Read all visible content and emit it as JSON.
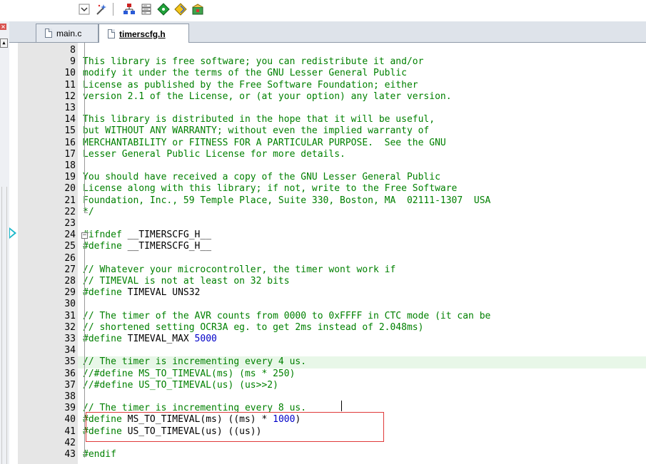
{
  "toolbar": {
    "buttons": [
      {
        "name": "dropdown-arrow-icon"
      },
      {
        "name": "magic-wand-icon"
      },
      {
        "name": "hierarchy-icon"
      },
      {
        "name": "stack-icon"
      },
      {
        "name": "green-diamond-icon"
      },
      {
        "name": "yellow-diamond-icon"
      },
      {
        "name": "package-icon"
      }
    ]
  },
  "tabs": [
    {
      "label": "main.c",
      "active": false
    },
    {
      "label": "timerscfg.h",
      "active": true
    }
  ],
  "editor": {
    "lines": [
      {
        "n": "8",
        "parts": [
          [
            "com",
            ""
          ]
        ]
      },
      {
        "n": "9",
        "parts": [
          [
            "com",
            "This library is free software; you can redistribute it and/or"
          ]
        ]
      },
      {
        "n": "10",
        "parts": [
          [
            "com",
            "modify it under the terms of the GNU Lesser General Public"
          ]
        ]
      },
      {
        "n": "11",
        "parts": [
          [
            "com",
            "License as published by the Free Software Foundation; either"
          ]
        ]
      },
      {
        "n": "12",
        "parts": [
          [
            "com",
            "version 2.1 of the License, or (at your option) any later version."
          ]
        ]
      },
      {
        "n": "13",
        "parts": [
          [
            "com",
            ""
          ]
        ]
      },
      {
        "n": "14",
        "parts": [
          [
            "com",
            "This library is distributed in the hope that it will be useful,"
          ]
        ]
      },
      {
        "n": "15",
        "parts": [
          [
            "com",
            "but WITHOUT ANY WARRANTY; without even the implied warranty of"
          ]
        ]
      },
      {
        "n": "16",
        "parts": [
          [
            "com",
            "MERCHANTABILITY or FITNESS FOR A PARTICULAR PURPOSE.  See the GNU"
          ]
        ]
      },
      {
        "n": "17",
        "parts": [
          [
            "com",
            "Lesser General Public License for more details."
          ]
        ]
      },
      {
        "n": "18",
        "parts": [
          [
            "com",
            ""
          ]
        ]
      },
      {
        "n": "19",
        "parts": [
          [
            "com",
            "You should have received a copy of the GNU Lesser General Public"
          ]
        ]
      },
      {
        "n": "20",
        "parts": [
          [
            "com",
            "License along with this library; if not, write to the Free Software"
          ]
        ]
      },
      {
        "n": "21",
        "parts": [
          [
            "com",
            "Foundation, Inc., 59 Temple Place, Suite 330, Boston, MA  02111-1307  USA"
          ]
        ]
      },
      {
        "n": "22",
        "parts": [
          [
            "com",
            "*/"
          ]
        ]
      },
      {
        "n": "23",
        "parts": [
          [
            "id",
            ""
          ]
        ]
      },
      {
        "n": "24",
        "parts": [
          [
            "pp",
            "#ifndef"
          ],
          [
            "id",
            " __TIMERSCFG_H__"
          ]
        ]
      },
      {
        "n": "25",
        "parts": [
          [
            "pp",
            "#define"
          ],
          [
            "id",
            " __TIMERSCFG_H__"
          ]
        ]
      },
      {
        "n": "26",
        "parts": [
          [
            "id",
            ""
          ]
        ]
      },
      {
        "n": "27",
        "parts": [
          [
            "com",
            "// Whatever your microcontroller, the timer wont work if"
          ]
        ]
      },
      {
        "n": "28",
        "parts": [
          [
            "com",
            "// TIMEVAL is not at least on 32 bits"
          ]
        ]
      },
      {
        "n": "29",
        "parts": [
          [
            "pp",
            "#define"
          ],
          [
            "id",
            " TIMEVAL UNS32"
          ]
        ]
      },
      {
        "n": "30",
        "parts": [
          [
            "id",
            ""
          ]
        ]
      },
      {
        "n": "31",
        "parts": [
          [
            "com",
            "// The timer of the AVR counts from 0000 to 0xFFFF in CTC mode (it can be"
          ]
        ]
      },
      {
        "n": "32",
        "parts": [
          [
            "com",
            "// shortened setting OCR3A eg. to get 2ms instead of 2.048ms)"
          ]
        ]
      },
      {
        "n": "33",
        "parts": [
          [
            "pp",
            "#define"
          ],
          [
            "id",
            " TIMEVAL_MAX "
          ],
          [
            "num",
            "5000"
          ]
        ]
      },
      {
        "n": "34",
        "parts": [
          [
            "id",
            ""
          ]
        ]
      },
      {
        "n": "35",
        "parts": [
          [
            "com",
            "// The timer is incrementing every 4 us."
          ]
        ]
      },
      {
        "n": "36",
        "parts": [
          [
            "com",
            "//#define MS_TO_TIMEVAL(ms) (ms * 250)"
          ]
        ]
      },
      {
        "n": "37",
        "parts": [
          [
            "com",
            "//#define US_TO_TIMEVAL(us) (us>>2)"
          ]
        ]
      },
      {
        "n": "38",
        "parts": [
          [
            "id",
            ""
          ]
        ]
      },
      {
        "n": "39",
        "parts": [
          [
            "com",
            "// The timer is incrementing every 8 us."
          ]
        ]
      },
      {
        "n": "40",
        "parts": [
          [
            "pp",
            "#define"
          ],
          [
            "id",
            " MS_TO_TIMEVAL(ms) ((ms) * "
          ],
          [
            "num",
            "1000"
          ],
          [
            "id",
            ")"
          ]
        ]
      },
      {
        "n": "41",
        "parts": [
          [
            "pp",
            "#define"
          ],
          [
            "id",
            " US_TO_TIMEVAL(us) ((us))"
          ]
        ]
      },
      {
        "n": "42",
        "parts": [
          [
            "id",
            ""
          ]
        ]
      },
      {
        "n": "43",
        "parts": [
          [
            "pp",
            "#endif"
          ]
        ]
      }
    ],
    "current_line": "35",
    "colors": {
      "comment": "#008000",
      "preprocessor": "#008000",
      "number": "#0000c8",
      "highlight_box": "#e03a3a",
      "current_line_bg": "#e8f7e8",
      "exec_arrow": "#19b7c9"
    }
  }
}
